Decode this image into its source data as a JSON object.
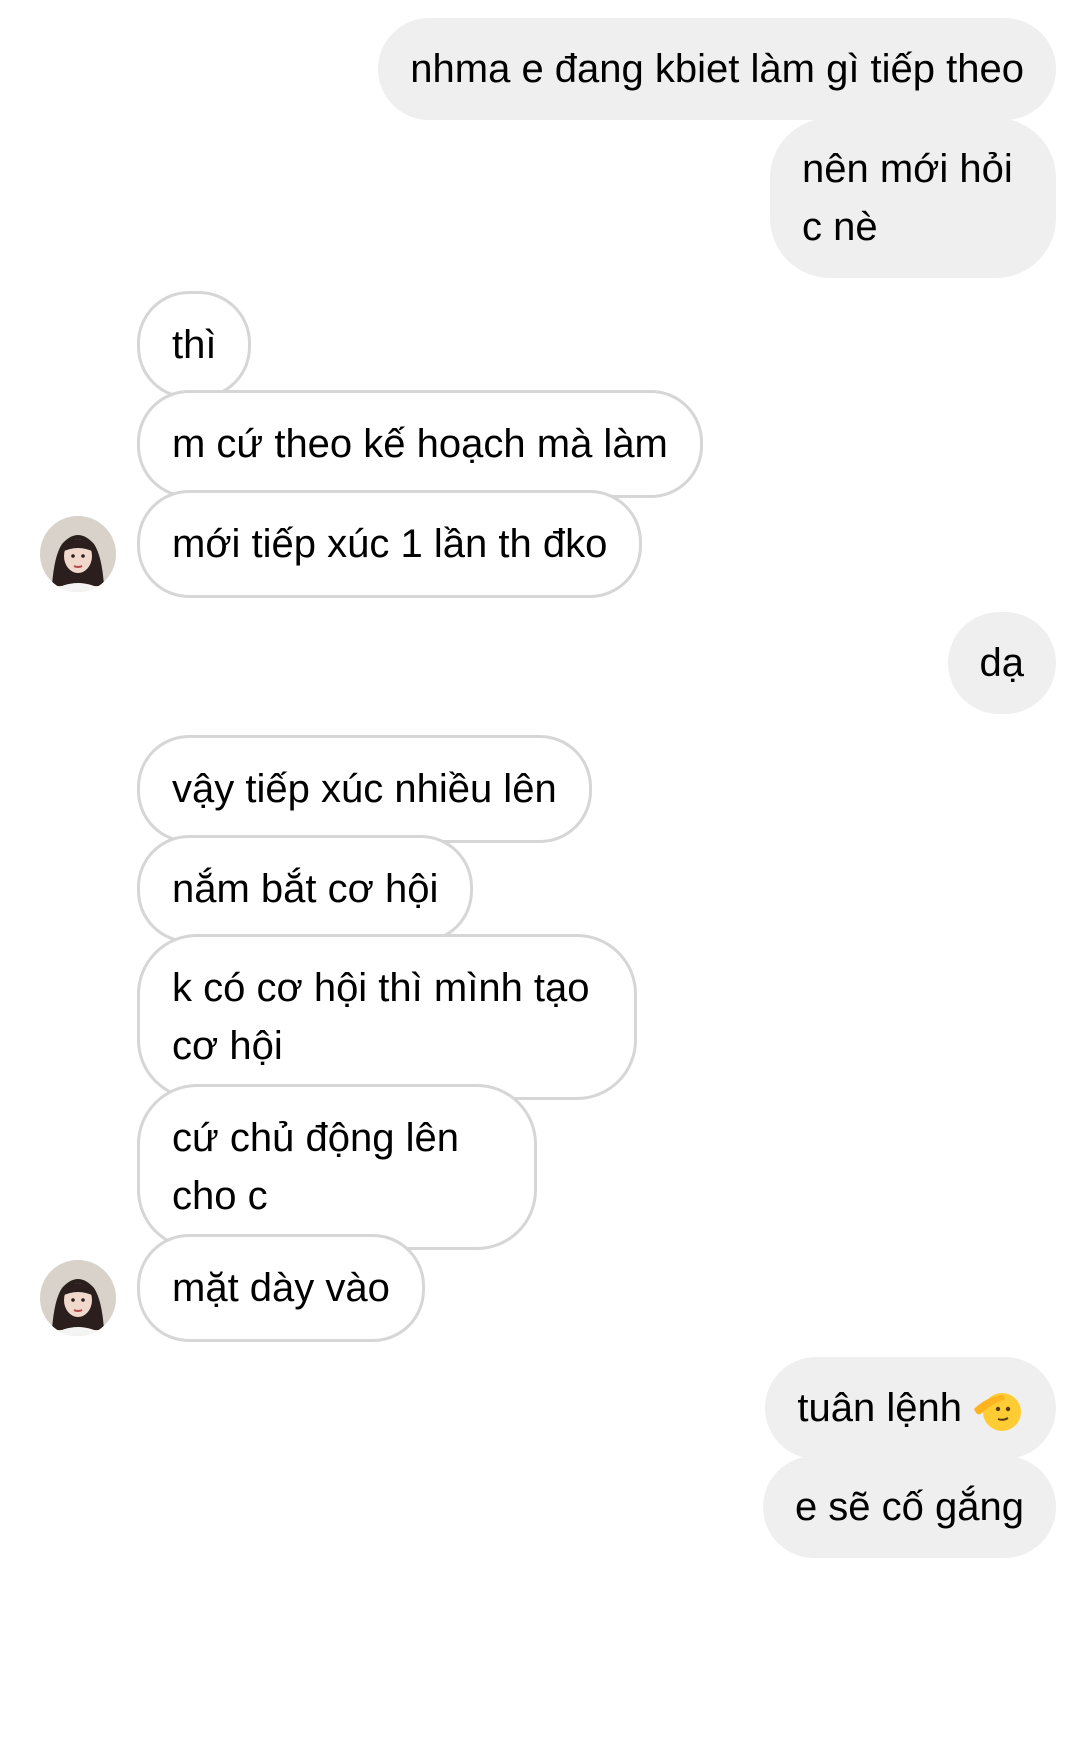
{
  "messages": [
    {
      "side": "sent",
      "text": "nhma e đang kbiet làm gì tiếp theo"
    },
    {
      "side": "sent",
      "text": "nên mới hỏi c nè"
    },
    {
      "side": "received",
      "text": "thì"
    },
    {
      "side": "received",
      "text": "m cứ theo kế hoạch mà làm"
    },
    {
      "side": "received",
      "text": "mới tiếp xúc 1 lần th đko"
    },
    {
      "side": "sent",
      "text": "dạ"
    },
    {
      "side": "received",
      "text": "vậy tiếp xúc nhiều lên"
    },
    {
      "side": "received",
      "text": "nắm bắt cơ hội"
    },
    {
      "side": "received",
      "text": "k có cơ hội thì mình tạo cơ hội"
    },
    {
      "side": "received",
      "text": "cứ chủ động lên cho c"
    },
    {
      "side": "received",
      "text": "mặt dày vào"
    },
    {
      "side": "sent",
      "text": "tuân lệnh",
      "emoji": "saluting-face-icon"
    },
    {
      "side": "sent",
      "text": "e sẽ cố gắng"
    }
  ],
  "colors": {
    "sent_bubble": "#efefef",
    "received_border": "#d6d6d6",
    "text": "#000000"
  },
  "avatar": {
    "icon": "contact-avatar"
  }
}
